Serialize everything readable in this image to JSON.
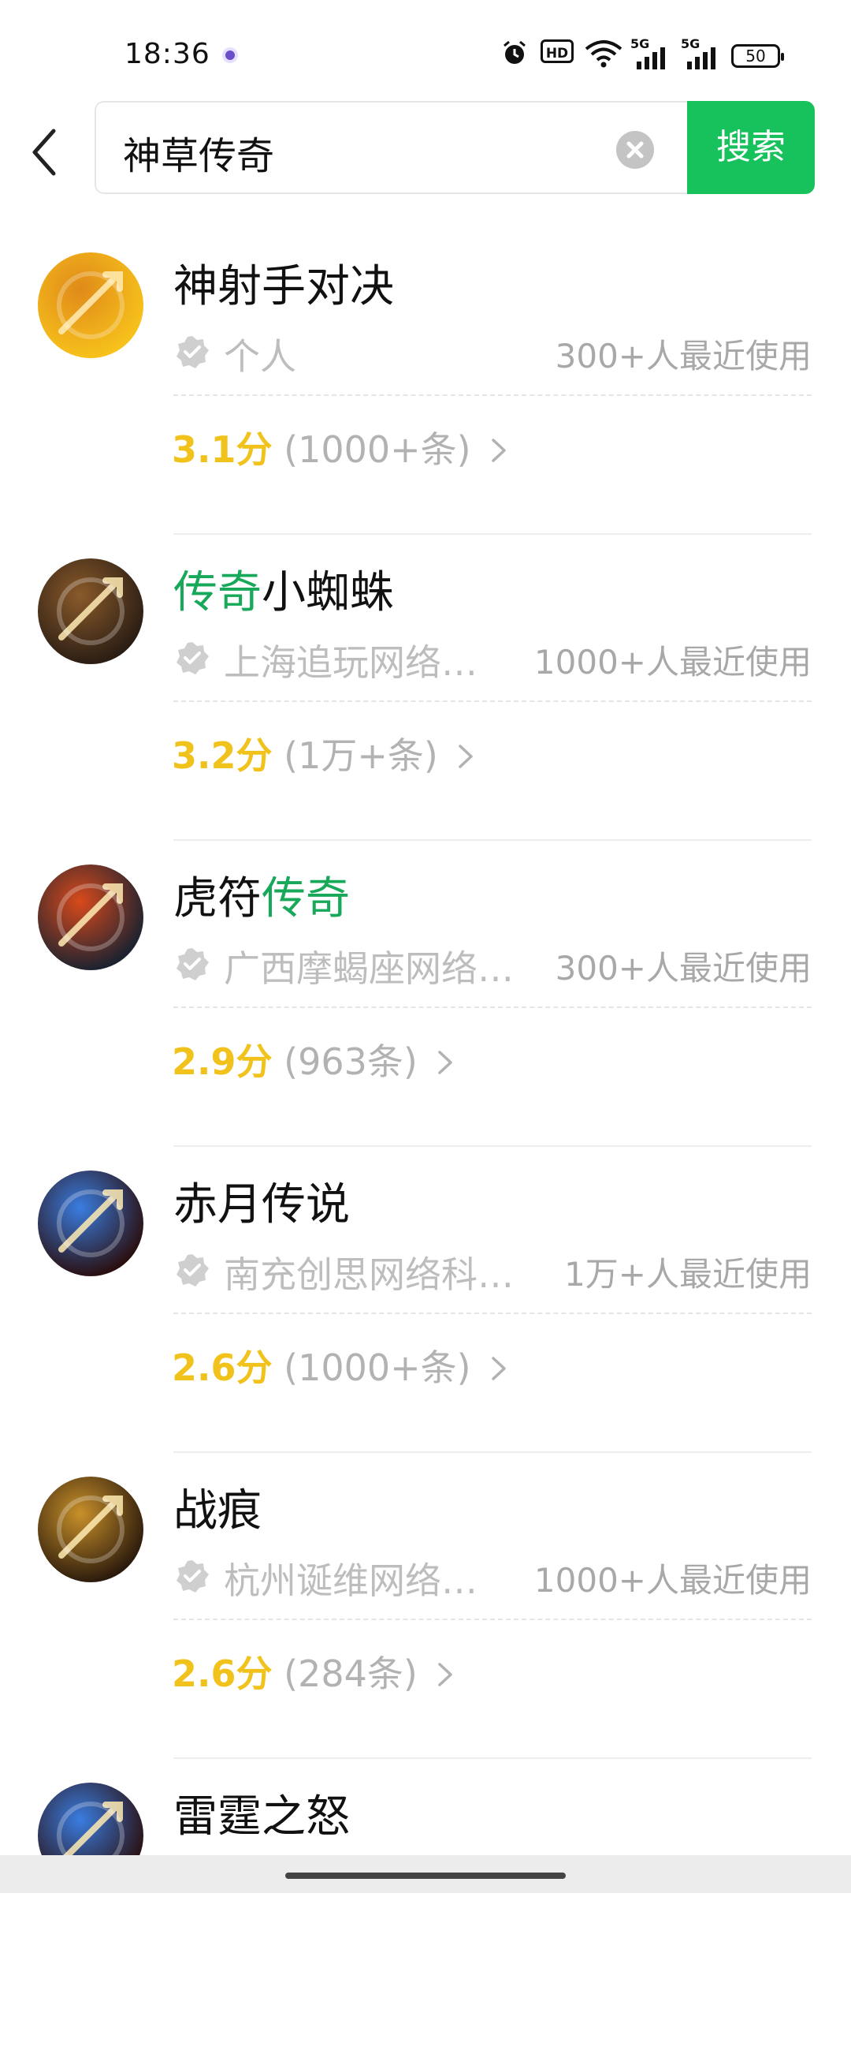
{
  "status_bar": {
    "time": "18:36",
    "hd_label": "HD",
    "signal_1": "5G",
    "signal_2": "5G",
    "battery": "50"
  },
  "search": {
    "query": "神草传奇",
    "button_label": "搜索"
  },
  "results": [
    {
      "title_pre": "神射手对决",
      "title_hl": "",
      "title_post": "",
      "org": "个人",
      "users": "300+人最近使用",
      "score": "3.1分",
      "count": "(1000+条)",
      "avatar_icon": "bow-arrow-game-icon",
      "avatar_colors": [
        "#f7c21b",
        "#e08a1a"
      ]
    },
    {
      "title_pre": "",
      "title_hl": "传奇",
      "title_post": "小蜘蛛",
      "org": "上海追玩网络…",
      "users": "1000+人最近使用",
      "score": "3.2分",
      "count": "(1万+条)",
      "avatar_icon": "dragon-glyph-game-icon",
      "avatar_colors": [
        "#2a1d14",
        "#8a5a2a"
      ]
    },
    {
      "title_pre": "虎符",
      "title_hl": "传奇",
      "title_post": "",
      "org": "广西摩蝎座网络…",
      "users": "300+人最近使用",
      "score": "2.9分",
      "count": "(963条)",
      "avatar_icon": "flame-blade-game-icon",
      "avatar_colors": [
        "#1b2230",
        "#d84a1c"
      ]
    },
    {
      "title_pre": "赤月传说",
      "title_hl": "",
      "title_post": "",
      "org": "南充创思网络科…",
      "users": "1万+人最近使用",
      "score": "2.6分",
      "count": "(1000+条)",
      "avatar_icon": "colorful-dragon-game-icon",
      "avatar_colors": [
        "#2a0f0f",
        "#3a7de0"
      ]
    },
    {
      "title_pre": "战痕",
      "title_hl": "",
      "title_post": "",
      "org": "杭州诞维网络…",
      "users": "1000+人最近使用",
      "score": "2.6分",
      "count": "(284条)",
      "avatar_icon": "legend-glyph-game-icon",
      "avatar_colors": [
        "#2b1a0c",
        "#c8902a"
      ]
    },
    {
      "title_pre": "雷霆之怒",
      "title_hl": "",
      "title_post": "",
      "org": "",
      "users": "",
      "score": "",
      "count": "",
      "avatar_icon": "colorful-dragon-game-icon",
      "avatar_colors": [
        "#2a0f0f",
        "#3a7de0"
      ]
    }
  ]
}
